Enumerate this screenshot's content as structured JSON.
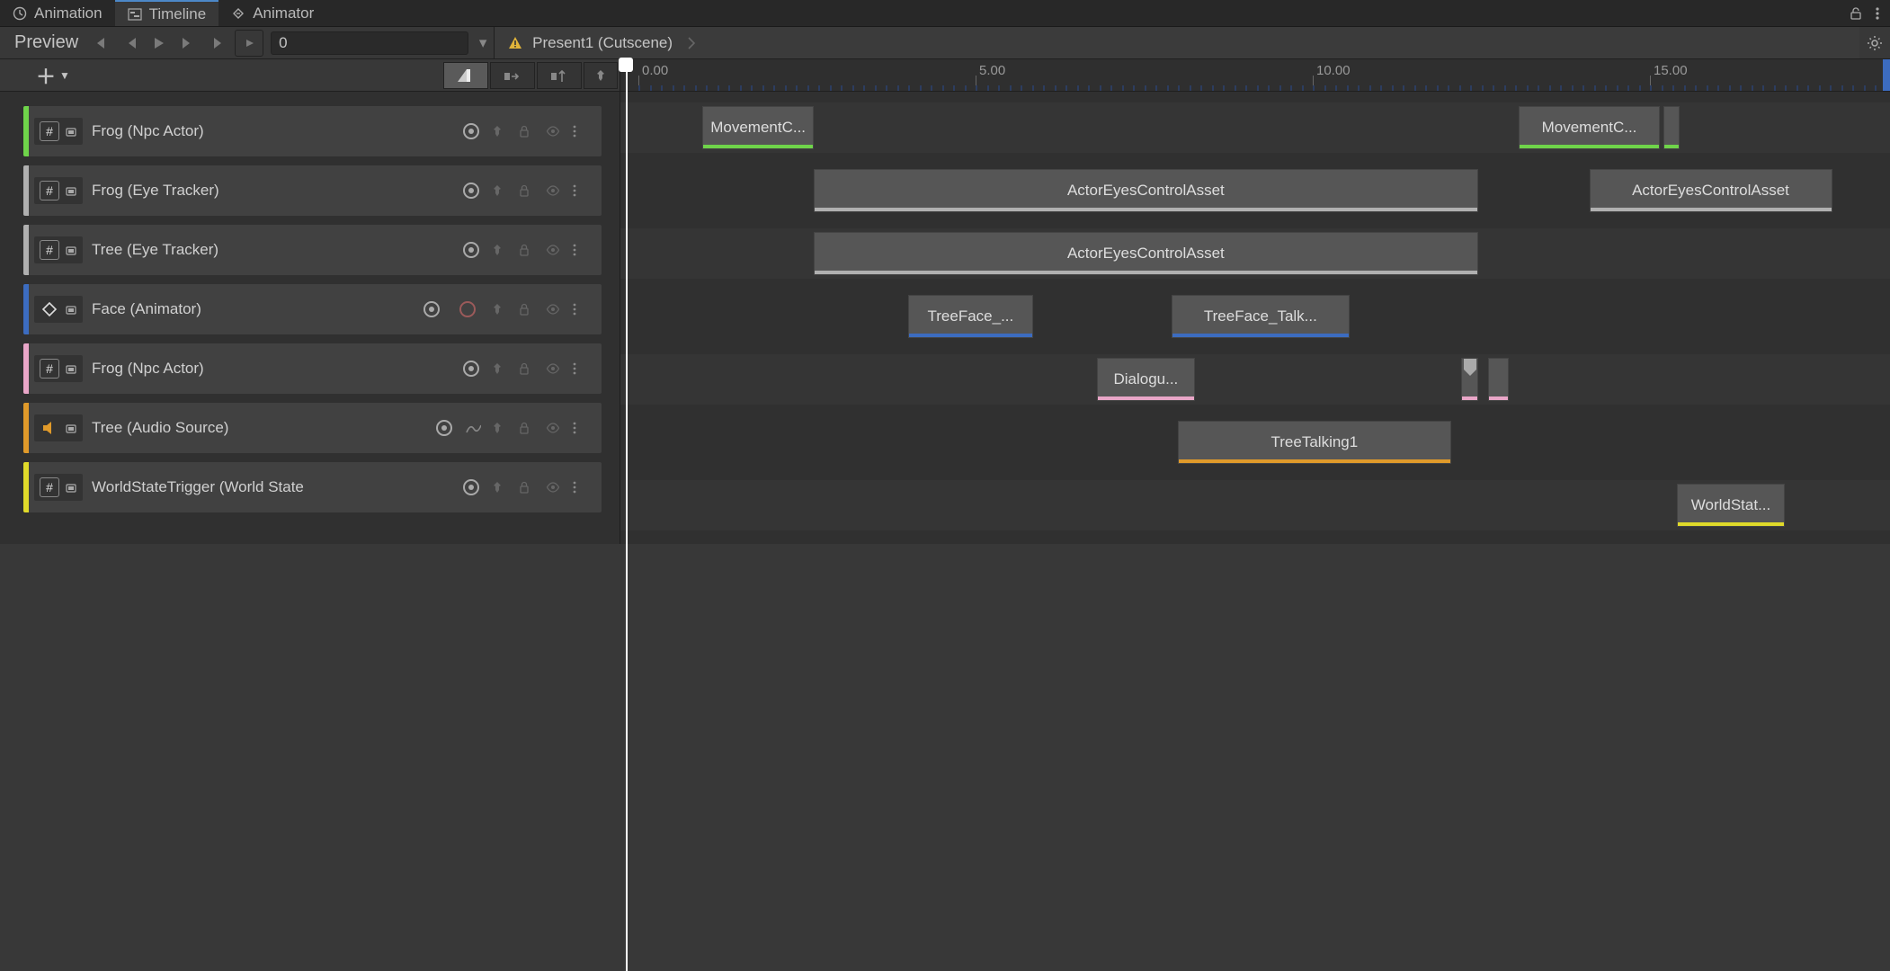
{
  "tabs": {
    "animation": "Animation",
    "timeline": "Timeline",
    "animator": "Animator"
  },
  "toolbar": {
    "preview": "Preview",
    "frame": "0"
  },
  "breadcrumb": {
    "asset": "Present1 (Cutscene)"
  },
  "ruler": {
    "ticks": [
      "0.00",
      "5.00",
      "10.00",
      "15.00"
    ]
  },
  "tracks": [
    {
      "name": "Frog (Npc Actor)",
      "color": "#6fd44a",
      "icon": "hash",
      "recordable": false
    },
    {
      "name": "Frog (Eye Tracker)",
      "color": "#b0b0b0",
      "icon": "hash",
      "recordable": false
    },
    {
      "name": "Tree (Eye Tracker)",
      "color": "#b0b0b0",
      "icon": "hash",
      "recordable": false
    },
    {
      "name": "Face (Animator)",
      "color": "#3c6cc0",
      "icon": "animator",
      "recordable": true
    },
    {
      "name": "Frog (Npc Actor)",
      "color": "#e9a6c8",
      "icon": "hash",
      "recordable": false
    },
    {
      "name": "Tree (Audio Source)",
      "color": "#e09a2a",
      "icon": "audio",
      "recordable": false,
      "curve": true
    },
    {
      "name": "WorldStateTrigger (World State",
      "color": "#e0da2a",
      "icon": "hash",
      "recordable": false
    }
  ],
  "clips": {
    "t0": [
      {
        "label": "MovementC...",
        "start": 0.95,
        "end": 2.6,
        "cls": "clip-green"
      },
      {
        "label": "MovementC...",
        "start": 13.05,
        "end": 15.15,
        "cls": "clip-green"
      },
      {
        "label": "",
        "start": 15.2,
        "end": 15.4,
        "cls": "clip-green"
      }
    ],
    "t1": [
      {
        "label": "ActorEyesControlAsset",
        "start": 2.6,
        "end": 12.45,
        "cls": "clip-gray"
      },
      {
        "label": "ActorEyesControlAsset",
        "start": 14.1,
        "end": 17.7,
        "cls": "clip-gray"
      }
    ],
    "t2": [
      {
        "label": "ActorEyesControlAsset",
        "start": 2.6,
        "end": 12.45,
        "cls": "clip-gray"
      }
    ],
    "t3": [
      {
        "label": "TreeFace_...",
        "start": 4.0,
        "end": 5.85,
        "cls": "clip-blue"
      },
      {
        "label": "TreeFace_Talk...",
        "start": 7.9,
        "end": 10.55,
        "cls": "clip-blue"
      }
    ],
    "t4": [
      {
        "label": "Dialogu...",
        "start": 6.8,
        "end": 8.25,
        "cls": "clip-pink"
      },
      {
        "label": "",
        "start": 12.2,
        "end": 12.45,
        "cls": "clip-pink",
        "marker": true
      },
      {
        "label": "",
        "start": 12.6,
        "end": 12.9,
        "cls": "clip-pink"
      }
    ],
    "t5": [
      {
        "label": "TreeTalking1",
        "start": 8.0,
        "end": 12.05,
        "cls": "clip-orange"
      }
    ],
    "t6": [
      {
        "label": "WorldStat...",
        "start": 15.4,
        "end": 17.0,
        "cls": "clip-yellow"
      }
    ]
  },
  "timescale": {
    "start": 0,
    "pxPerUnit": 75,
    "origin": 20
  }
}
